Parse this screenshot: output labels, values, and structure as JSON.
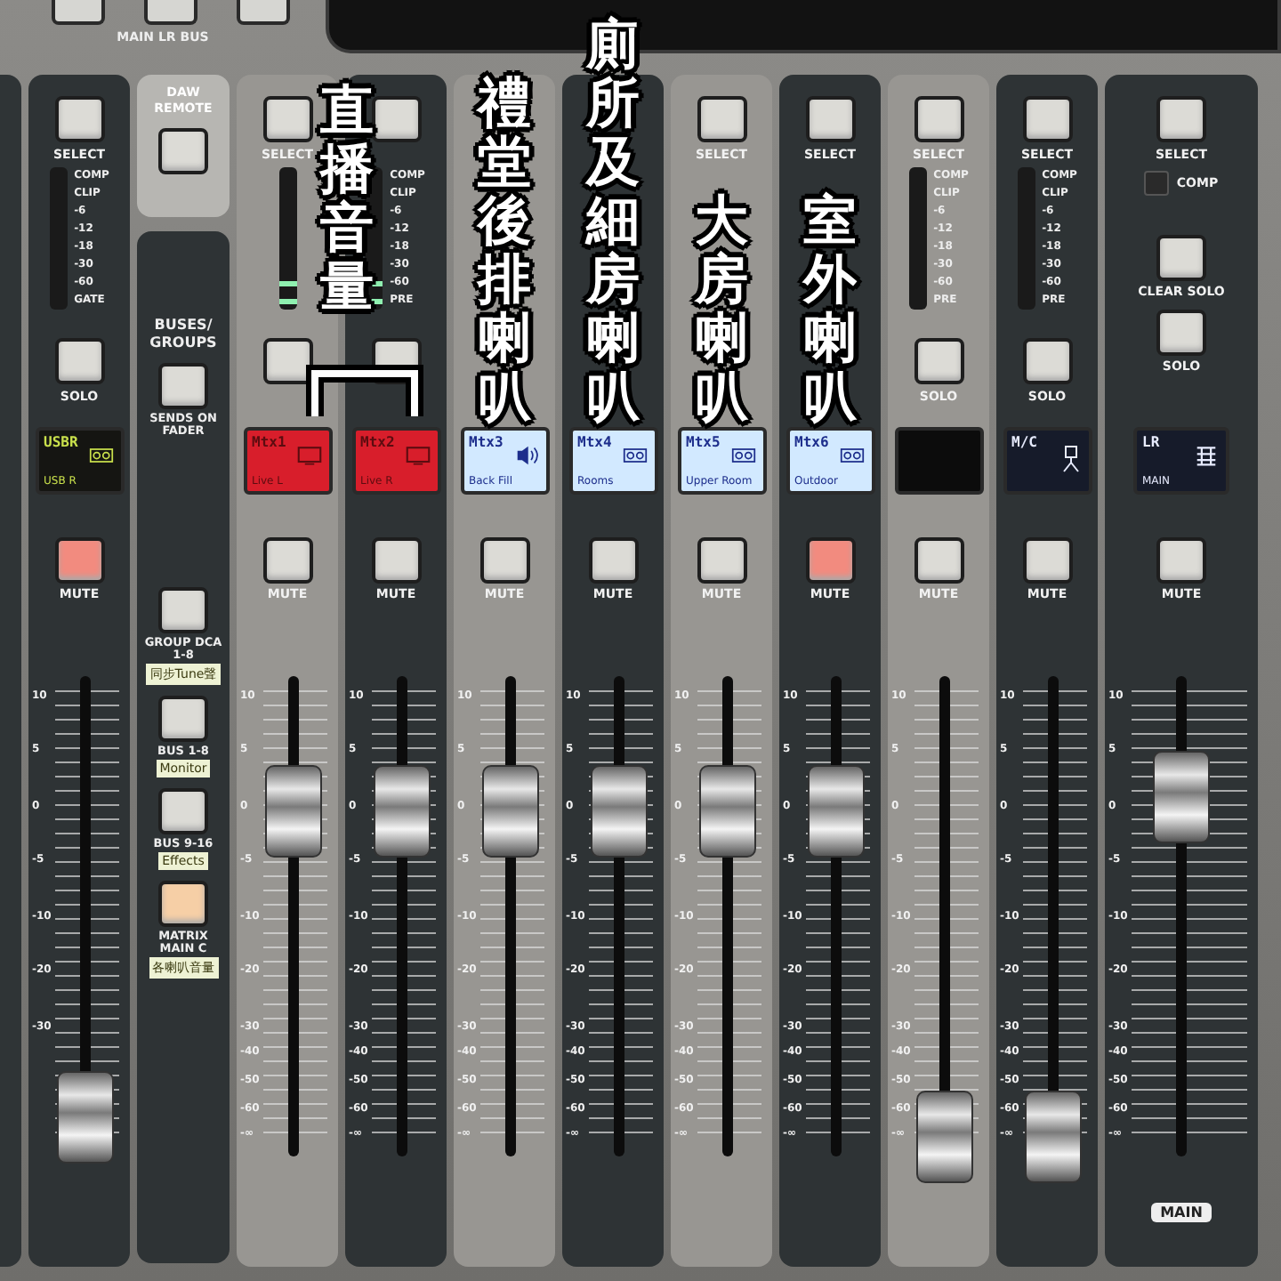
{
  "top_panel": {
    "label": "MAIN LR BUS"
  },
  "group_annotation": {
    "text": "直播音量"
  },
  "strips": [
    {
      "kind": "partial"
    },
    {
      "kind": "channel",
      "select_label": "SELECT",
      "meter": {
        "level": 0,
        "labels": [
          "COMP",
          "CLIP",
          "-6",
          "-12",
          "-18",
          "-30",
          "-60",
          "GATE"
        ]
      },
      "solo_label": "SOLO",
      "lcd": {
        "kind": "usb",
        "title": "USBR",
        "subtitle": "USB R",
        "color": "#151512"
      },
      "mute": {
        "label": "MUTE",
        "on": true
      },
      "fader": {
        "level": 0.08,
        "scale": [
          "10",
          "5",
          "0",
          "-5",
          "-10",
          "-20",
          "-30"
        ]
      }
    },
    {
      "kind": "buses",
      "daw_label": "DAW REMOTE",
      "title": "BUSES/ GROUPS",
      "buttons": [
        {
          "label": "SENDS ON FADER",
          "selected": false
        },
        {
          "label": "GROUP DCA 1-8",
          "tag": "同步Tune聲",
          "selected": false
        },
        {
          "label": "BUS 1-8",
          "tag": "Monitor",
          "selected": false
        },
        {
          "label": "BUS 9-16",
          "tag": "Effects",
          "selected": false
        },
        {
          "label": "MATRIX MAIN C",
          "tag": "各喇叭音量",
          "selected": true
        }
      ]
    },
    {
      "kind": "channel",
      "select_label": "SELECT",
      "meter": {
        "level": 0.25
      },
      "lcd": {
        "kind": "screen",
        "title": "Mtx1",
        "subtitle": "Live L",
        "color": "#d81e2b"
      },
      "mute": {
        "label": "MUTE",
        "on": false
      },
      "fader": {
        "level": 0.72,
        "scale": [
          "10",
          "5",
          "0",
          "-5",
          "-10",
          "-20",
          "-30",
          "-40",
          "-50",
          "-60",
          "-∞"
        ]
      }
    },
    {
      "kind": "channel",
      "meter": {
        "level": 0.25,
        "labels": [
          "COMP",
          "CLIP",
          "-6",
          "-12",
          "-18",
          "-30",
          "-60",
          "PRE"
        ]
      },
      "lcd": {
        "kind": "screen",
        "title": "Mtx2",
        "subtitle": "Live R",
        "color": "#d81e2b"
      },
      "mute": {
        "label": "MUTE",
        "on": false
      },
      "fader": {
        "level": 0.72,
        "scale": [
          "10",
          "5",
          "0",
          "-5",
          "-10",
          "-20",
          "-30",
          "-40",
          "-50",
          "-60",
          "-∞"
        ]
      }
    },
    {
      "kind": "channel",
      "annotation": "禮堂後排喇叭",
      "lcd": {
        "kind": "speaker",
        "title": "Mtx3",
        "subtitle": "Back Fill",
        "color": "#d2e9ff"
      },
      "mute": {
        "label": "MUTE",
        "on": false
      },
      "fader": {
        "level": 0.72,
        "scale": [
          "10",
          "5",
          "0",
          "-5",
          "-10",
          "-20",
          "-30",
          "-40",
          "-50",
          "-60",
          "-∞"
        ]
      }
    },
    {
      "kind": "channel",
      "annotation": "廁所及細房喇叭",
      "lcd": {
        "kind": "tape",
        "title": "Mtx4",
        "subtitle": "Rooms",
        "color": "#d2e9ff"
      },
      "mute": {
        "label": "MUTE",
        "on": false
      },
      "fader": {
        "level": 0.72,
        "scale": [
          "10",
          "5",
          "0",
          "-5",
          "-10",
          "-20",
          "-30",
          "-40",
          "-50",
          "-60",
          "-∞"
        ]
      }
    },
    {
      "kind": "channel",
      "select_label": "SELECT",
      "annotation": "大房喇叭",
      "lcd": {
        "kind": "tape",
        "title": "Mtx5",
        "subtitle": "Upper Room",
        "color": "#d2e9ff"
      },
      "mute": {
        "label": "MUTE",
        "on": false
      },
      "fader": {
        "level": 0.72,
        "scale": [
          "10",
          "5",
          "0",
          "-5",
          "-10",
          "-20",
          "-30",
          "-40",
          "-50",
          "-60",
          "-∞"
        ]
      }
    },
    {
      "kind": "channel",
      "select_label": "SELECT",
      "annotation": "室外喇叭",
      "lcd": {
        "kind": "tape",
        "title": "Mtx6",
        "subtitle": "Outdoor",
        "color": "#d2e9ff"
      },
      "mute": {
        "label": "MUTE",
        "on": true
      },
      "fader": {
        "level": 0.72,
        "scale": [
          "10",
          "5",
          "0",
          "-5",
          "-10",
          "-20",
          "-30",
          "-40",
          "-50",
          "-60",
          "-∞"
        ]
      }
    },
    {
      "kind": "channel",
      "select_label": "SELECT",
      "meter": {
        "level": 0,
        "labels": [
          "COMP",
          "CLIP",
          "-6",
          "-12",
          "-18",
          "-30",
          "-60",
          "PRE"
        ]
      },
      "solo_label": "SOLO",
      "lcd": {
        "kind": "blank",
        "color": "#0c0c0c"
      },
      "mute": {
        "label": "MUTE",
        "on": false
      },
      "fader": {
        "level": 0.04,
        "scale": [
          "10",
          "5",
          "0",
          "-5",
          "-10",
          "-20",
          "-30",
          "-40",
          "-50",
          "-60",
          "-∞"
        ]
      }
    },
    {
      "kind": "channel",
      "select_label": "SELECT",
      "meter": {
        "level": 0,
        "labels": [
          "COMP",
          "CLIP",
          "-6",
          "-12",
          "-18",
          "-30",
          "-60",
          "PRE"
        ]
      },
      "solo_label": "SOLO",
      "lcd": {
        "kind": "person",
        "title": "M/C",
        "color": "#161b2a"
      },
      "mute": {
        "label": "MUTE",
        "on": false
      },
      "fader": {
        "level": 0.04,
        "scale": [
          "10",
          "5",
          "0",
          "-5",
          "-10",
          "-20",
          "-30",
          "-40",
          "-50",
          "-60",
          "-∞"
        ]
      }
    },
    {
      "kind": "main",
      "select_label": "SELECT",
      "comp_label": "COMP",
      "clear_solo_label": "CLEAR SOLO",
      "solo_label": "SOLO",
      "lcd": {
        "kind": "grid",
        "title": "LR",
        "subtitle": "MAIN",
        "color": "#161b2a"
      },
      "mute": {
        "label": "MUTE",
        "on": false
      },
      "fader": {
        "level": 0.75,
        "scale": [
          "10",
          "5",
          "0",
          "-5",
          "-10",
          "-20",
          "-30",
          "-40",
          "-50",
          "-60",
          "-∞"
        ]
      },
      "badge": "MAIN"
    }
  ]
}
